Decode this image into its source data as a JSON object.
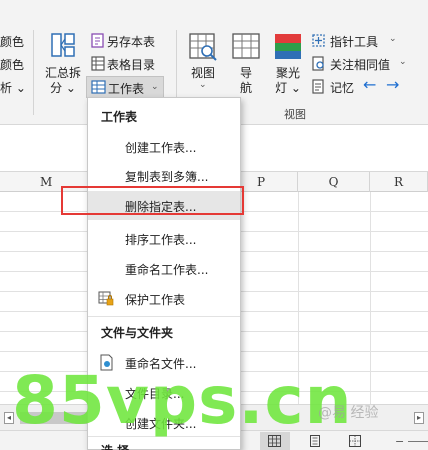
{
  "ribbon": {
    "left_cut": [
      "颜色",
      "颜色",
      "析 ⌄"
    ],
    "summary_split": {
      "line1": "汇总拆",
      "line2": "分 ⌄"
    },
    "save_as_book": "另存本表",
    "table_catalog": "表格目录",
    "worksheet_button": "工作表",
    "view_button": "视图",
    "nav_button": {
      "line1": "导",
      "line2": "航"
    },
    "spotlight_button": {
      "line1": "聚光",
      "line2": "灯 ⌄"
    },
    "pointer_tool": "指针工具",
    "focus_same_value": "关注相同值",
    "memory": "记忆",
    "group_view_label": "视图"
  },
  "columns": [
    "M",
    "P",
    "Q",
    "R"
  ],
  "menu": {
    "section1": "工作表",
    "items1": [
      "创建工作表...",
      "复制表到多簿...",
      "删除指定表...",
      "排序工作表...",
      "重命名工作表...",
      "保护工作表"
    ],
    "section2": "文件与文件夹",
    "items2": [
      "重命名文件...",
      "文件目录...",
      "创建文件夹..."
    ],
    "section3_partial": "选 择 …"
  },
  "watermark": "85vps.cn",
  "watermark_small": "@易 经验",
  "colors": {
    "highlight_box": "#e53935",
    "accent_blue": "#1f6fd1",
    "watermark_green": "#6ee63c"
  }
}
